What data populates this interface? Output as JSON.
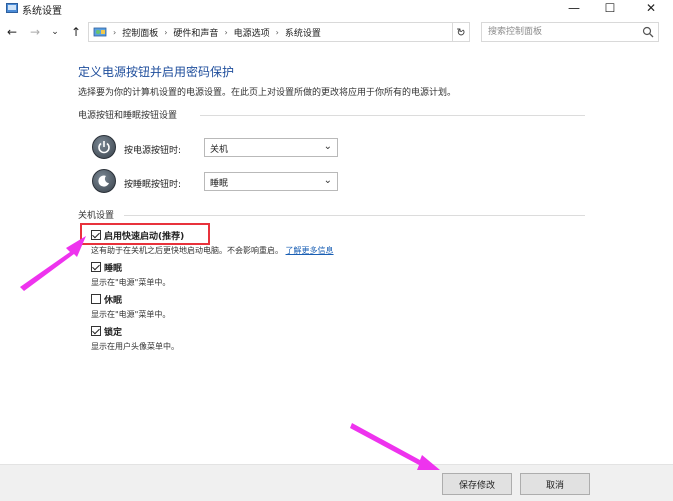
{
  "window": {
    "title": "系统设置",
    "minimize_glyph": "—",
    "maximize_glyph": "☐",
    "close_glyph": "✕"
  },
  "nav": {
    "back_glyph": "←",
    "forward_glyph": "→",
    "history_glyph": "⌄",
    "up_glyph": "↑",
    "breadcrumb": [
      "控制面板",
      "硬件和声音",
      "电源选项",
      "系统设置"
    ],
    "breadcrumb_sep": "›",
    "dropdown_glyph": "⌄",
    "refresh_glyph": "↻",
    "search_placeholder": "搜索控制面板"
  },
  "page": {
    "title": "定义电源按钮并启用密码保护",
    "description": "选择要为你的计算机设置的电源设置。在此页上对设置所做的更改将应用于你所有的电源计划。"
  },
  "power_section": {
    "label": "电源按钮和睡眠按钮设置",
    "power_button_label": "按电源按钮时:",
    "power_button_value": "关机",
    "sleep_button_label": "按睡眠按钮时:",
    "sleep_button_value": "睡眠",
    "dropdown_glyph": "⌄"
  },
  "shutdown_section": {
    "label": "关机设置",
    "items": [
      {
        "label": "启用快速启动(推荐)",
        "checked": true,
        "desc": "这有助于在关机之后更快地启动电脑。不会影响重启。",
        "link": "了解更多信息"
      },
      {
        "label": "睡眠",
        "checked": true,
        "desc": "显示在\"电源\"菜单中。"
      },
      {
        "label": "休眠",
        "checked": false,
        "desc": "显示在\"电源\"菜单中。"
      },
      {
        "label": "锁定",
        "checked": true,
        "desc": "显示在用户头像菜单中。"
      }
    ]
  },
  "footer": {
    "save_label": "保存修改",
    "cancel_label": "取消"
  },
  "colors": {
    "title_blue": "#1f4e9c",
    "annotation_magenta": "#ee33ee",
    "highlight_red": "#e8323c"
  }
}
